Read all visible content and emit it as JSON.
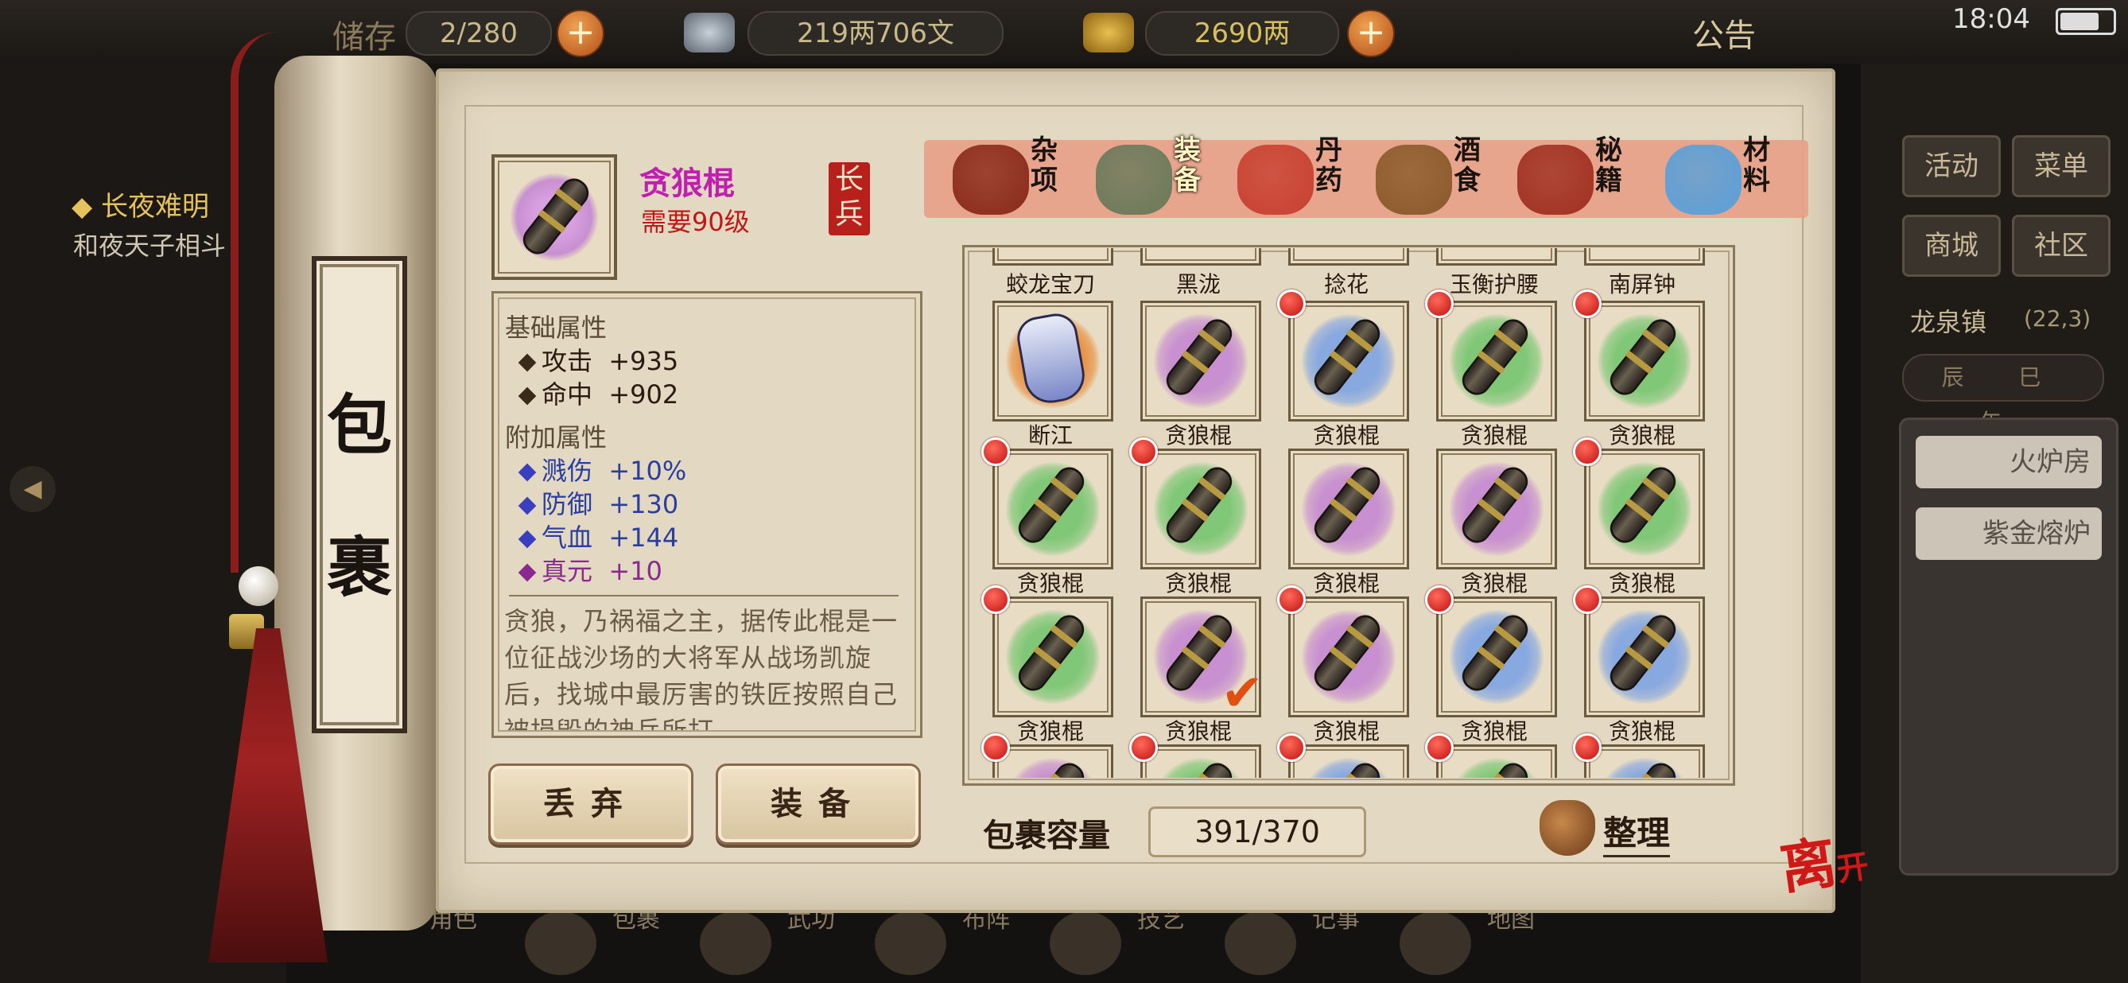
{
  "topbar": {
    "storage_label": "储存",
    "storage_value": "2/280",
    "copper_value": "219两706文",
    "gold_value": "2690两",
    "announcement": "公告",
    "time": "18:04"
  },
  "quest": {
    "title": "◆ 长夜难明",
    "text": "和夜天子相斗"
  },
  "right_panel": {
    "buttons": [
      "活动",
      "菜单",
      "商城",
      "社区"
    ],
    "location": "龙泉镇",
    "coords": "(22,3)",
    "compass": "辰 巳 午",
    "rooms": [
      "火炉房",
      "紫金熔炉"
    ]
  },
  "bottom_nav": [
    "角色",
    "包裹",
    "武功",
    "布阵",
    "技艺",
    "记事",
    "地图"
  ],
  "bag": {
    "label_char1": "包",
    "label_char2": "裹"
  },
  "item": {
    "name": "贪狼棍",
    "requirement": "需要90级",
    "type": "长兵",
    "base_section": "基础属性",
    "base_stats": [
      {
        "name": "攻击",
        "value": "+935"
      },
      {
        "name": "命中",
        "value": "+902"
      }
    ],
    "extra_section": "附加属性",
    "extra_stats": [
      {
        "name": "溅伤",
        "value": "+10%"
      },
      {
        "name": "防御",
        "value": "+130"
      },
      {
        "name": "气血",
        "value": "+144"
      },
      {
        "name": "真元",
        "value": "+10"
      }
    ],
    "description": "贪狼，乃祸福之主，据传此棍是一位征战沙场的大将军从战场凯旋后，找城中最厉害的铁匠按照自己被损毁的神兵所打"
  },
  "actions": {
    "discard": "丢弃",
    "equip": "装备"
  },
  "tabs": [
    {
      "label": "杂项",
      "icon": "jar-icon",
      "color": "#8a2a1a"
    },
    {
      "label": "装备",
      "icon": "scroll-weapon-icon",
      "color": "#6a7a5a",
      "active": true
    },
    {
      "label": "丹药",
      "icon": "pills-icon",
      "color": "#c84030"
    },
    {
      "label": "酒食",
      "icon": "food-icon",
      "color": "#8a5a2a"
    },
    {
      "label": "秘籍",
      "icon": "books-icon",
      "color": "#a03020"
    },
    {
      "label": "材料",
      "icon": "crystal-icon",
      "color": "#5aa0d8"
    }
  ],
  "grid": {
    "top_row_labels": [
      "蛟龙宝刀",
      "黑泷",
      "捻花",
      "玉衡护腰",
      "南屏钟"
    ],
    "rows": [
      [
        {
          "label": "断江",
          "kind": "glove",
          "color": "#e89040",
          "dot": false,
          "check": false
        },
        {
          "label": "贪狼棍",
          "kind": "club",
          "color": "#c890d0",
          "dot": false,
          "check": false
        },
        {
          "label": "贪狼棍",
          "kind": "club",
          "color": "#88a8e0",
          "dot": true,
          "check": false
        },
        {
          "label": "贪狼棍",
          "kind": "club",
          "color": "#80c878",
          "dot": true,
          "check": false
        },
        {
          "label": "贪狼棍",
          "kind": "club",
          "color": "#80c878",
          "dot": true,
          "check": false
        }
      ],
      [
        {
          "label": "贪狼棍",
          "kind": "club",
          "color": "#80c878",
          "dot": true,
          "check": false
        },
        {
          "label": "贪狼棍",
          "kind": "club",
          "color": "#80c878",
          "dot": true,
          "check": false
        },
        {
          "label": "贪狼棍",
          "kind": "club",
          "color": "#c890d0",
          "dot": false,
          "check": false
        },
        {
          "label": "贪狼棍",
          "kind": "club",
          "color": "#c890d0",
          "dot": false,
          "check": false
        },
        {
          "label": "贪狼棍",
          "kind": "club",
          "color": "#80c878",
          "dot": true,
          "check": false
        }
      ],
      [
        {
          "label": "贪狼棍",
          "kind": "club",
          "color": "#80c878",
          "dot": true,
          "check": false
        },
        {
          "label": "贪狼棍",
          "kind": "club",
          "color": "#c890d0",
          "dot": false,
          "check": true
        },
        {
          "label": "贪狼棍",
          "kind": "club",
          "color": "#c890d0",
          "dot": true,
          "check": false
        },
        {
          "label": "贪狼棍",
          "kind": "club",
          "color": "#88a8e0",
          "dot": true,
          "check": false
        },
        {
          "label": "贪狼棍",
          "kind": "club",
          "color": "#88a8e0",
          "dot": true,
          "check": false
        }
      ],
      [
        {
          "label": "",
          "kind": "club",
          "color": "#c890d0",
          "dot": true,
          "check": false
        },
        {
          "label": "",
          "kind": "club",
          "color": "#80c878",
          "dot": true,
          "check": false
        },
        {
          "label": "",
          "kind": "club",
          "color": "#88a8e0",
          "dot": true,
          "check": false
        },
        {
          "label": "",
          "kind": "club",
          "color": "#80c878",
          "dot": true,
          "check": false
        },
        {
          "label": "",
          "kind": "club",
          "color": "#88a8e0",
          "dot": true,
          "check": false
        }
      ]
    ]
  },
  "capacity": {
    "label": "包裹容量",
    "value": "391/370"
  },
  "sort_label": "整理",
  "leave": {
    "char1": "离",
    "char2": "开"
  },
  "colors": {
    "item_name": "#c020b0",
    "requirement": "#c01818",
    "extra_stat_blue": "#2a3ea0",
    "extra_stat_purple": "#8a2a90"
  }
}
